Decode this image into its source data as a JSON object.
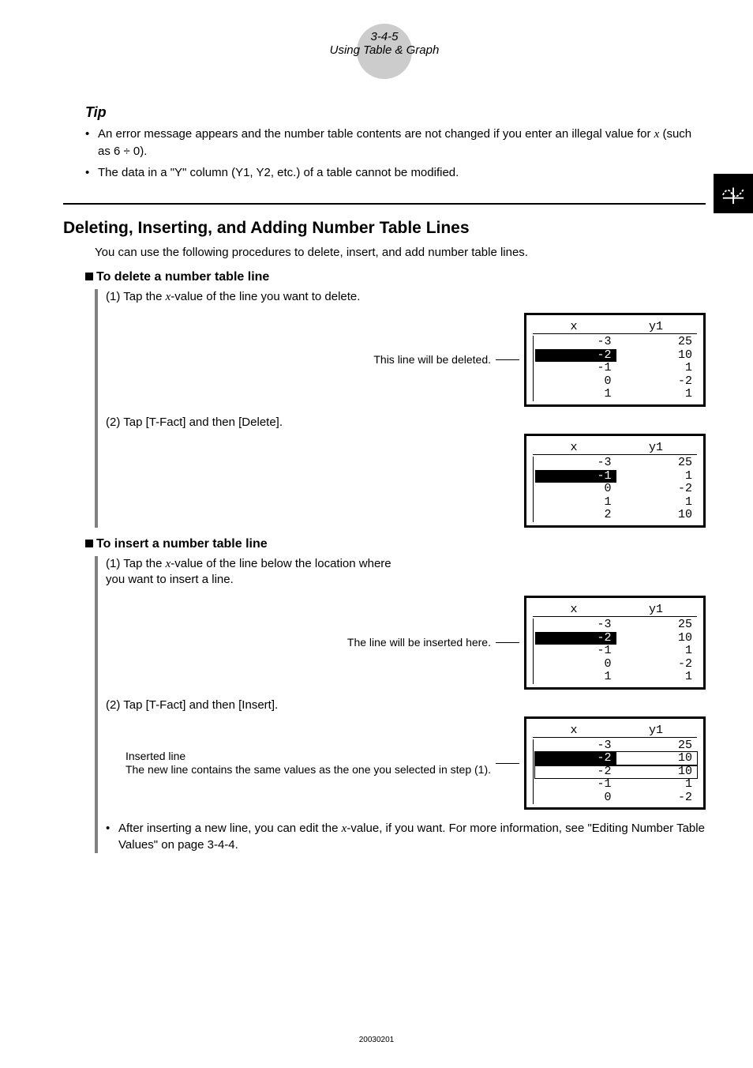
{
  "header": {
    "pagenum": "3-4-5",
    "title": "Using Table & Graph"
  },
  "tip": {
    "label": "Tip",
    "items": [
      {
        "pre": "An error message appears and the number table contents are not changed if you enter an illegal value for ",
        "var": "x",
        "post": " (such as 6 ÷ 0)."
      },
      {
        "pre": "The data in a \"Y\" column (Y1, Y2, etc.) of a table cannot be modified.",
        "var": "",
        "post": ""
      }
    ]
  },
  "section": {
    "title": "Deleting, Inserting, and Adding Number Table Lines",
    "intro": "You can use the following procedures to delete, insert, and add number table lines."
  },
  "delete": {
    "heading": "To delete a number table line",
    "step1_pre": "(1) Tap the ",
    "step1_var": "x",
    "step1_post": "-value of the line you want to delete.",
    "caption1": "This line will be deleted.",
    "step2": "(2) Tap [T-Fact] and then [Delete].",
    "tables": {
      "before": {
        "head": [
          "x",
          "y1"
        ],
        "rows": [
          {
            "x": "-3",
            "y": "25",
            "hl": false
          },
          {
            "x": "-2",
            "y": "10",
            "hl": true
          },
          {
            "x": "-1",
            "y": "1",
            "hl": false
          },
          {
            "x": "0",
            "y": "-2",
            "hl": false
          },
          {
            "x": "1",
            "y": "1",
            "hl": false
          }
        ]
      },
      "after": {
        "head": [
          "x",
          "y1"
        ],
        "rows": [
          {
            "x": "-3",
            "y": "25",
            "hl": false
          },
          {
            "x": "-1",
            "y": "1",
            "hl": true
          },
          {
            "x": "0",
            "y": "-2",
            "hl": false
          },
          {
            "x": "1",
            "y": "1",
            "hl": false
          },
          {
            "x": "2",
            "y": "10",
            "hl": false
          }
        ]
      }
    }
  },
  "insert": {
    "heading": "To insert a number table line",
    "step1_pre": "(1) Tap the ",
    "step1_var": "x",
    "step1_post": "-value of the line below the location where you want to insert a line.",
    "caption1": "The line will be inserted here.",
    "step2": "(2) Tap [T-Fact] and then [Insert].",
    "caption2a": "Inserted line",
    "caption2b": "The new line contains the same values as the one you selected in step (1).",
    "note_pre": "After inserting a new line, you can edit the ",
    "note_var": "x",
    "note_post": "-value, if you want. For more information, see \"Editing Number Table Values\" on page 3-4-4.",
    "tables": {
      "before": {
        "head": [
          "x",
          "y1"
        ],
        "rows": [
          {
            "x": "-3",
            "y": "25",
            "hl": false
          },
          {
            "x": "-2",
            "y": "10",
            "hl": true
          },
          {
            "x": "-1",
            "y": "1",
            "hl": false
          },
          {
            "x": "0",
            "y": "-2",
            "hl": false
          },
          {
            "x": "1",
            "y": "1",
            "hl": false
          }
        ]
      },
      "after": {
        "head": [
          "x",
          "y1"
        ],
        "rows": [
          {
            "x": "-3",
            "y": "25",
            "hl": false
          },
          {
            "x": "-2",
            "y": "10",
            "hl": true,
            "outlined": true
          },
          {
            "x": "-2",
            "y": "10",
            "hl": false,
            "outlined": true
          },
          {
            "x": "-1",
            "y": "1",
            "hl": false
          },
          {
            "x": "0",
            "y": "-2",
            "hl": false
          }
        ]
      }
    }
  },
  "footer": {
    "code": "20030201"
  }
}
